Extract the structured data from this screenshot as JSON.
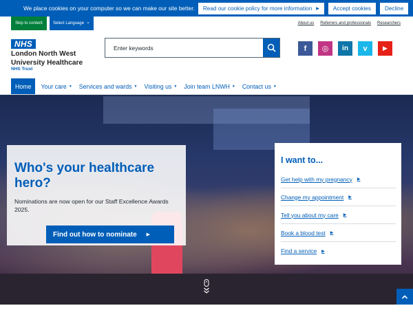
{
  "cookie": {
    "text": "We place cookies on your computer so we can make our site better.",
    "policy_label": "Read our cookie policy for more information",
    "accept_label": "Accept cookies",
    "decline_label": "Decline"
  },
  "utility": {
    "skip_label": "Skip to content",
    "language_label": "Select Language",
    "links": [
      "About us",
      "Referrers and professionals",
      "Researchers"
    ]
  },
  "header": {
    "logo_text": "NHS",
    "org_line1": "London North West",
    "org_line2": "University Healthcare",
    "org_sub": "NHS Trust",
    "search_placeholder": "Enter keywords",
    "social": [
      {
        "name": "facebook-icon",
        "glyph": "f",
        "color": "#3b5998"
      },
      {
        "name": "instagram-icon",
        "glyph": "◎",
        "color": "#c13584"
      },
      {
        "name": "linkedin-icon",
        "glyph": "in",
        "color": "#0e76a8"
      },
      {
        "name": "vimeo-icon",
        "glyph": "v",
        "color": "#1ab7ea"
      },
      {
        "name": "youtube-icon",
        "glyph": "▶",
        "color": "#e62117"
      }
    ]
  },
  "nav": {
    "items": [
      "Home",
      "Your care",
      "Services and wards",
      "Visiting us",
      "Join team LNWH",
      "Contact us"
    ]
  },
  "hero": {
    "title": "Who's your healthcare hero?",
    "text": "Nominations are now open for our Staff Excellence Awards 2025.",
    "cta_label": "Find out how to nominate"
  },
  "want": {
    "title": "I want to...",
    "items": [
      "Get help with my pregnancy",
      "Change my appointment",
      "Tell you about my care",
      "Book a blood test",
      "Find a service"
    ]
  },
  "colors": {
    "brand": "#005eb8",
    "skip": "#007f3b"
  }
}
